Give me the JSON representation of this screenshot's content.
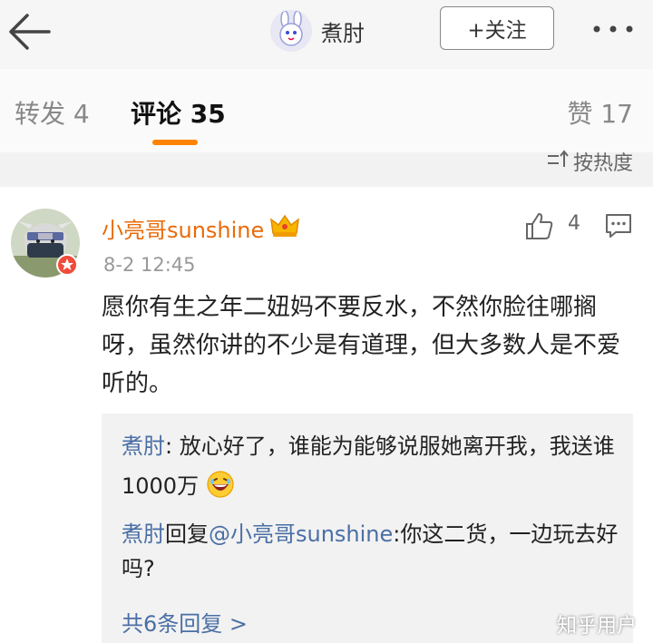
{
  "header": {
    "title": "煮肘",
    "follow_label": "+关注",
    "back_icon": "back-arrow-icon",
    "more_icon": "more-dots-icon"
  },
  "tabs": {
    "repost": "转发 4",
    "comments": "评论 35",
    "likes": "赞 17",
    "active_color": "#ff8200"
  },
  "sort": {
    "label": "按热度",
    "icon": "sort-icon"
  },
  "comment": {
    "username": "小亮哥sunshine",
    "time": "8-2 12:45",
    "like_count": "4",
    "text": "愿你有生之年二妞妈不要反水，不然你脸往哪搁呀，虽然你讲的不少是有道理，但大多数人是不爱听的。",
    "badge_icon": "crown-icon",
    "username_color": "#e86b0a"
  },
  "replies": [
    {
      "author": "煮肘",
      "text": ": 放心好了，谁能为能够说服她离开我，我送谁1000万",
      "emoji": "laughing-emoji-icon"
    },
    {
      "author": "煮肘",
      "reply_word": "回复",
      "mention": "@小亮哥sunshine",
      "text": ":你这二货，一边玩去好吗?"
    }
  ],
  "more_replies": "共6条回复 >",
  "watermark": "知乎用户",
  "link_color": "#4a6fa5"
}
